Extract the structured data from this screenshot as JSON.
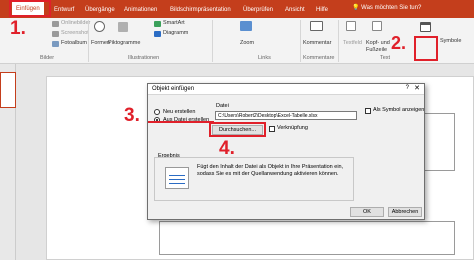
{
  "ribbon": {
    "tabs": [
      "Einfügen",
      "Entwurf",
      "Übergänge",
      "Animationen",
      "Bildschirmpräsentation",
      "Überprüfen",
      "Ansicht",
      "Hilfe"
    ],
    "tell_me": "Was möchten Sie tun?",
    "items": {
      "onlinebilder": "Onlinebilder",
      "screenshot": "Screenshot",
      "fotoalbum": "Fotoalbum",
      "formen": "Formen",
      "piktogramme": "Piktogramme",
      "smartart": "SmartArt",
      "diagramm": "Diagramm",
      "zoom": "Zoom",
      "kommentar": "Kommentar",
      "textfeld": "Textfeld",
      "kopf_fusszeile": "Kopf- und Fußzeile",
      "symbole": "Symbole"
    },
    "groups": {
      "bilder": "Bilder",
      "illustrationen": "Illustrationen",
      "links": "Links",
      "kommentare": "Kommentare",
      "text": "Text"
    }
  },
  "dialog": {
    "title": "Objekt einfügen",
    "help": "?",
    "close": "✕",
    "radio_new": "Neu erstellen",
    "radio_file": "Aus Datei erstellen",
    "file_label": "Datei",
    "file_path": "C:\\Users\\Robert2\\Desktop\\Excel-Tabelle.xlsx",
    "browse_button": "Durchsuchen...",
    "link_checkbox": "Verknüpfung",
    "symbol_checkbox": "Als Symbol anzeigen",
    "result_heading": "Ergebnis",
    "result_text": "Fügt den Inhalt der Datei als Objekt in Ihre Präsentation ein, sodass Sie es mit der Quellanwendung aktivieren können.",
    "ok": "OK",
    "cancel": "Abbrechen"
  },
  "annotations": [
    "1.",
    "2.",
    "3.",
    "4."
  ],
  "colors": {
    "accent": "#c43e1c",
    "annotation": "#e0202a"
  }
}
